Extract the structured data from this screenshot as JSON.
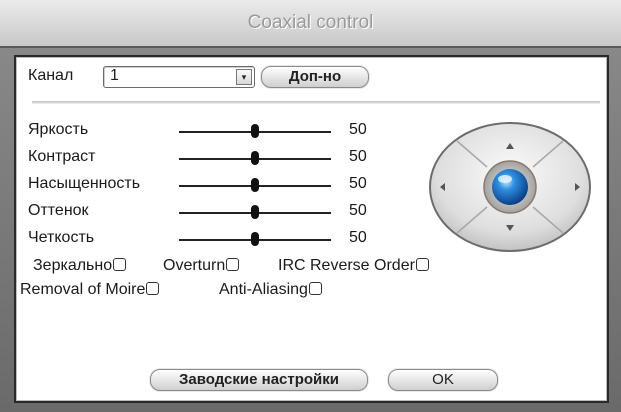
{
  "window": {
    "title": "Coaxial control"
  },
  "channel": {
    "label": "Канал",
    "value": "1",
    "advanced_label": "Доп-но"
  },
  "sliders": [
    {
      "label": "Яркость",
      "value": "50",
      "level": 0.5
    },
    {
      "label": "Контраст",
      "value": "50",
      "level": 0.5
    },
    {
      "label": "Насыщенность",
      "value": "50",
      "level": 0.5
    },
    {
      "label": "Оттенок",
      "value": "50",
      "level": 0.5
    },
    {
      "label": "Четкость",
      "value": "50",
      "level": 0.5
    }
  ],
  "options": [
    {
      "label": "Зеркально",
      "checked": false
    },
    {
      "label": "Overturn",
      "checked": false
    },
    {
      "label": "IRC Reverse Order",
      "checked": false
    },
    {
      "label": "Removal of Moire",
      "checked": false
    },
    {
      "label": "Anti-Aliasing",
      "checked": false
    }
  ],
  "buttons": {
    "defaults": "Заводские настройки",
    "ok": "OK"
  }
}
